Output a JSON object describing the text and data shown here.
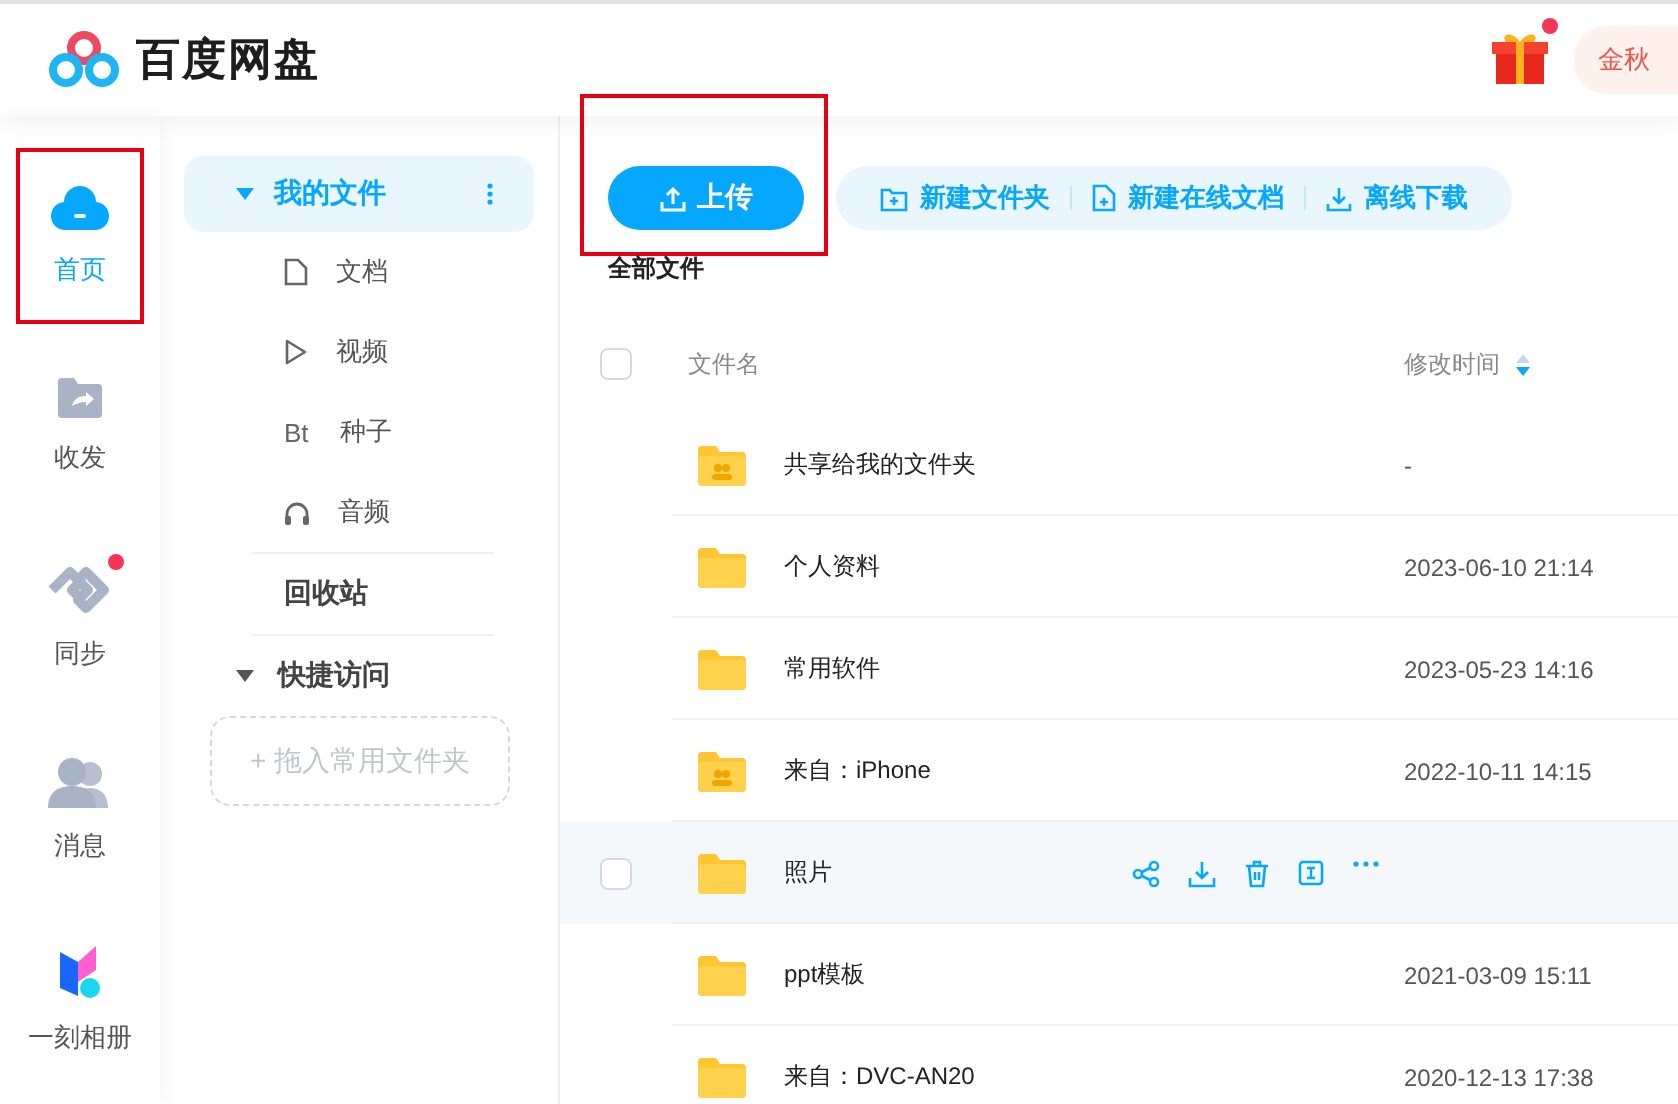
{
  "header": {
    "app_name": "百度网盘",
    "gift_badge": true,
    "promo": "金秋"
  },
  "rail": [
    {
      "label": "首页",
      "kind": "home",
      "selected": true,
      "annotated": true,
      "badge": false
    },
    {
      "label": "收发",
      "kind": "share",
      "selected": false,
      "annotated": false,
      "badge": false
    },
    {
      "label": "同步",
      "kind": "sync",
      "selected": false,
      "annotated": false,
      "badge": true
    },
    {
      "label": "消息",
      "kind": "message",
      "selected": false,
      "annotated": false,
      "badge": false
    }
  ],
  "rail_bottom": {
    "label": "一刻相册"
  },
  "sidebar": {
    "my_files": {
      "label": "我的文件",
      "selected": true,
      "expanded": true,
      "children": [
        {
          "label": "文档",
          "kind": "doc"
        },
        {
          "label": "视频",
          "kind": "video"
        },
        {
          "label": "种子",
          "kind": "torrent",
          "glyph": "Bt"
        },
        {
          "label": "音频",
          "kind": "audio"
        }
      ]
    },
    "recycle": "回收站",
    "quick": {
      "label": "快捷访问",
      "expanded": true
    },
    "drop_zone": "+ 拖入常用文件夹"
  },
  "toolbar": {
    "upload": {
      "label": "上传",
      "annotated": true
    },
    "actions": [
      {
        "label": "新建文件夹",
        "kind": "folder"
      },
      {
        "label": "新建在线文档",
        "kind": "doc"
      },
      {
        "label": "离线下载",
        "kind": "download"
      }
    ]
  },
  "breadcrumb": "全部文件",
  "table": {
    "columns": [
      "文件名",
      "修改时间"
    ],
    "select_all": {
      "checked": false
    },
    "rows": [
      {
        "name": "共享给我的文件夹",
        "time": "-",
        "kind": "shared",
        "hovered": false
      },
      {
        "name": "个人资料",
        "time": "2023-06-10 21:14",
        "kind": "folder",
        "hovered": false
      },
      {
        "name": "常用软件",
        "time": "2023-05-23 14:16",
        "kind": "folder",
        "hovered": false
      },
      {
        "name": "来自：iPhone",
        "time": "2022-10-11 14:15",
        "kind": "shared",
        "hovered": false
      },
      {
        "name": "照片",
        "kind": "folder",
        "hovered": true,
        "checked": false
      },
      {
        "name": "ppt模板",
        "time": "2021-03-09 15:11",
        "kind": "folder",
        "hovered": false
      },
      {
        "name": "来自：DVC-AN20",
        "time": "2020-12-13 17:38",
        "kind": "folder",
        "hovered": false
      }
    ]
  }
}
